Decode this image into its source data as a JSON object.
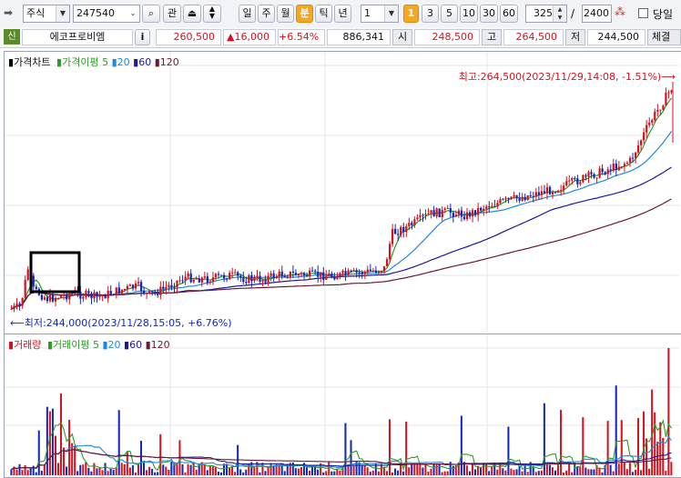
{
  "toolbar": {
    "market": "주식",
    "code": "247540",
    "watch_label": "관",
    "periods": [
      "일",
      "주",
      "월",
      "분",
      "틱",
      "년"
    ],
    "active_period": "분",
    "interval": "1",
    "interval_badge": "1",
    "quick_intervals": [
      "3",
      "5",
      "10",
      "30",
      "60"
    ],
    "count_value": "325",
    "separator": "/",
    "total_count": "2400",
    "today_label": "당일"
  },
  "quote": {
    "credit_badge": "신",
    "name": "에코프로비엠",
    "info_label": "i",
    "price": "260,500",
    "change": "▲16,000",
    "change_pct": "+6.54%",
    "volume": "886,341",
    "open_label": "시",
    "open": "248,500",
    "high_label": "고",
    "high": "264,500",
    "low_label": "저",
    "low": "244,500",
    "trade_label": "체결"
  },
  "colors": {
    "up": "#d5131f",
    "down": "#1228b8",
    "ma5": "#2e9b28",
    "ma20": "#1d8ad8",
    "ma60": "#1a1a9a",
    "ma120": "#6b1838"
  },
  "price_pane": {
    "title": "가격차트",
    "ma_label": "가격이평",
    "ma_periods": [
      "5",
      "20",
      "60",
      "120"
    ],
    "high_annotation": "최고:264,500(2023/11/29,14:08, -1.51%)⟶",
    "low_annotation": "⟵최저:244,000(2023/11/28,15:05, +6.76%)"
  },
  "volume_pane": {
    "title": "거래량",
    "ma_label": "거래이평",
    "ma_periods": [
      "5",
      "20",
      "60",
      "120"
    ]
  },
  "chart_data": {
    "type": "candlestick",
    "price_range": [
      244000,
      264500
    ],
    "y_axis_shown": false,
    "grid": true,
    "moving_averages": [
      "5",
      "20",
      "60",
      "120"
    ],
    "visible_bars": "325",
    "total_bars": "2400"
  }
}
